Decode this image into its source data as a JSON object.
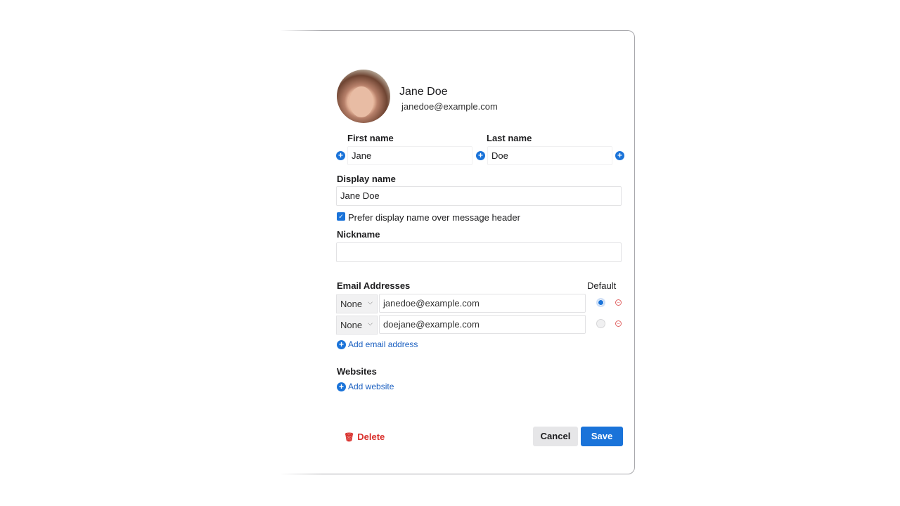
{
  "contact": {
    "name": "Jane Doe",
    "email": "janedoe@example.com"
  },
  "fields": {
    "first_name_label": "First name",
    "first_name": "Jane",
    "last_name_label": "Last name",
    "last_name": "Doe",
    "display_name_label": "Display name",
    "display_name": "Jane Doe",
    "prefer_display_label": "Prefer display name over message header",
    "prefer_display_checked": true,
    "nickname_label": "Nickname",
    "nickname": ""
  },
  "emails": {
    "label": "Email Addresses",
    "default_label": "Default",
    "items": [
      {
        "type": "None",
        "address": "janedoe@example.com",
        "default": true
      },
      {
        "type": "None",
        "address": "doejane@example.com",
        "default": false
      }
    ],
    "add_label": "Add email address"
  },
  "websites": {
    "label": "Websites",
    "add_label": "Add website"
  },
  "actions": {
    "delete": "Delete",
    "cancel": "Cancel",
    "save": "Save"
  },
  "colors": {
    "accent": "#1a73d9",
    "danger": "#d9302c"
  }
}
